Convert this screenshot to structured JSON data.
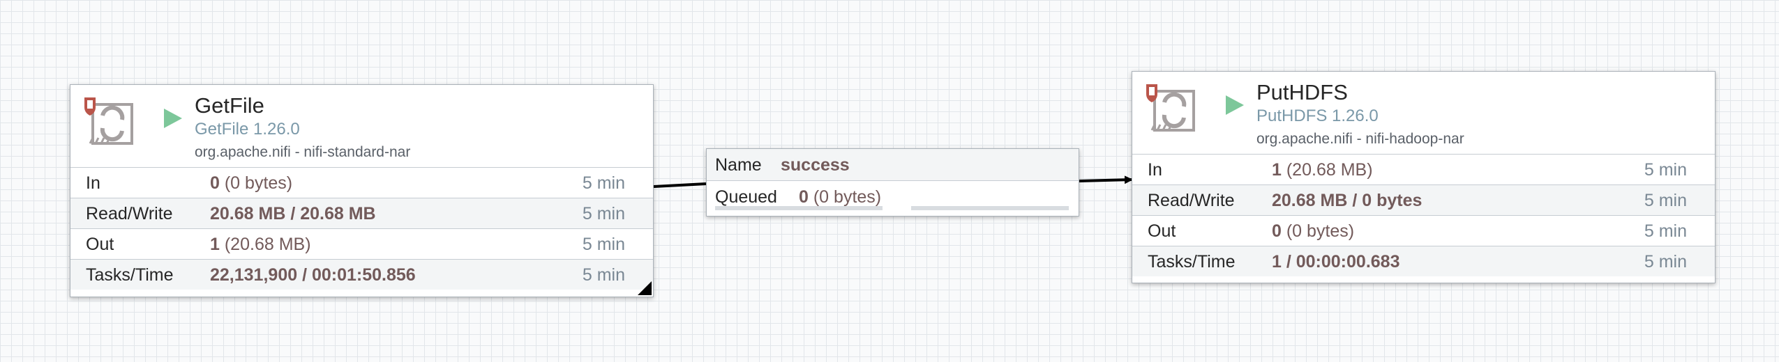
{
  "processors": [
    {
      "name": "GetFile",
      "type": "GetFile 1.26.0",
      "bundle": "org.apache.nifi - nifi-standard-nar",
      "stats": {
        "in": {
          "label": "In",
          "count": "0",
          "size": "(0 bytes)",
          "time": "5 min"
        },
        "read_write": {
          "label": "Read/Write",
          "value": "20.68 MB / 20.68 MB",
          "time": "5 min"
        },
        "out": {
          "label": "Out",
          "count": "1",
          "size": "(20.68 MB)",
          "time": "5 min"
        },
        "tasks_time": {
          "label": "Tasks/Time",
          "value": "22,131,900 / 00:01:50.856",
          "time": "5 min"
        }
      }
    },
    {
      "name": "PutHDFS",
      "type": "PutHDFS 1.26.0",
      "bundle": "org.apache.nifi - nifi-hadoop-nar",
      "stats": {
        "in": {
          "label": "In",
          "count": "1",
          "size": "(20.68 MB)",
          "time": "5 min"
        },
        "read_write": {
          "label": "Read/Write",
          "value": "20.68 MB / 0 bytes",
          "time": "5 min"
        },
        "out": {
          "label": "Out",
          "count": "0",
          "size": "(0 bytes)",
          "time": "5 min"
        },
        "tasks_time": {
          "label": "Tasks/Time",
          "value": "1 / 00:00:00.683",
          "time": "5 min"
        }
      }
    }
  ],
  "connection": {
    "name_label": "Name",
    "name": "success",
    "queued_label": "Queued",
    "queued_count": "0",
    "queued_size": "(0 bytes)"
  },
  "colors": {
    "running": "#7dc79a",
    "stat_value": "#725a5a",
    "type_text": "#7a98a8",
    "invalid_badge": "#ba554a",
    "icon_gray": "#a5a0a0"
  },
  "icons": {
    "processor": "processor-icon",
    "run_state": "play-icon",
    "invalid": "shield-icon"
  }
}
